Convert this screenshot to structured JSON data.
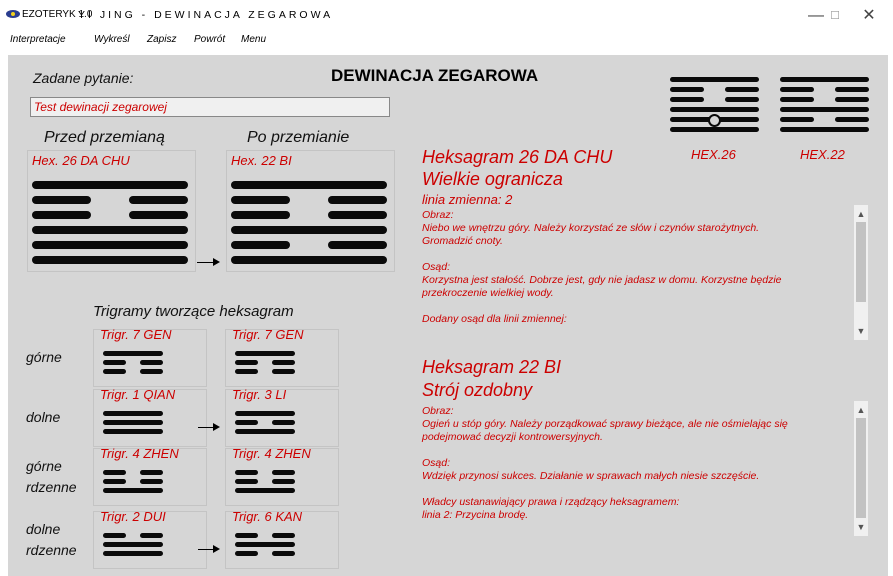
{
  "window": {
    "app_name": "EZOTERYK 1.0",
    "title": "YI JING - DEWINACJA ZEGAROWA",
    "minimize": "—",
    "maximize": "☐",
    "close": "✕"
  },
  "menu": [
    "Interpretacje",
    "Wykreśl",
    "Zapisz",
    "Powrót",
    "Menu"
  ],
  "heading": "DEWINACJA ZEGAROWA",
  "question": {
    "label": "Zadane pytanie:",
    "value": "Test dewinacji zegarowej"
  },
  "before": {
    "label": "Przed przemianą",
    "hex_label": "Hex. 26 DA CHU",
    "lines_bottom_to_top": [
      "yang",
      "yang",
      "yang",
      "yin",
      "yin",
      "yang"
    ]
  },
  "after": {
    "label": "Po przemianie",
    "hex_label": "Hex. 22 BI",
    "lines_bottom_to_top": [
      "yang",
      "yin",
      "yang",
      "yin",
      "yin",
      "yang"
    ]
  },
  "trigrams": {
    "title": "Trigramy tworzące heksagram",
    "rows": [
      {
        "label": "górne",
        "left": "Trigr. 7 GEN",
        "right": "Trigr. 7 GEN",
        "arrow": false
      },
      {
        "label": "dolne",
        "left": "Trigr. 1 QIAN",
        "right": "Trigr. 3 LI",
        "arrow": true
      },
      {
        "label": "górne\nrdzenne",
        "left": "Trigr. 4 ZHEN",
        "right": "Trigr. 4 ZHEN",
        "arrow": false
      },
      {
        "label": "dolne\nrdzenne",
        "left": "Trigr. 2 DUI",
        "right": "Trigr. 6 KAN",
        "arrow": true
      }
    ]
  },
  "small_hex": {
    "left_label": "HEX.26",
    "right_label": "HEX.22",
    "moving_line": 2
  },
  "hex1": {
    "title": "Heksagram 26 DA CHU",
    "subtitle": "Wielkie ogranicza",
    "moving": "linia zmienna: 2",
    "text": "Obraz:\nNiebo we wnętrzu góry. Należy korzystać ze słów i czynów starożytnych.\nGromadzić cnoty.\n\nOsąd:\nKorzystna jest stałość. Dobrze jest, gdy nie jadasz w domu. Korzystne będzie\nprzekroczenie wielkiej wody.\n\nDodany osąd dla linii zmiennej:"
  },
  "hex2": {
    "title": "Heksagram 22 BI",
    "subtitle": "Strój ozdobny",
    "text": "Obraz:\nOgień u stóp góry. Należy porządkować sprawy bieżące, ale nie ośmielając się\npodejmować decyzji kontrowersyjnych.\n\nOsąd:\nWdzięk przynosi sukces. Działanie w sprawach małych niesie szczęście.\n\nWładcy ustanawiający prawa i rządzący heksagramem:\nlinia 2: Przycina brodę."
  },
  "colors": {
    "accent": "#cc0000",
    "background": "#d6d6d6",
    "lines": "#0a0a0a"
  }
}
